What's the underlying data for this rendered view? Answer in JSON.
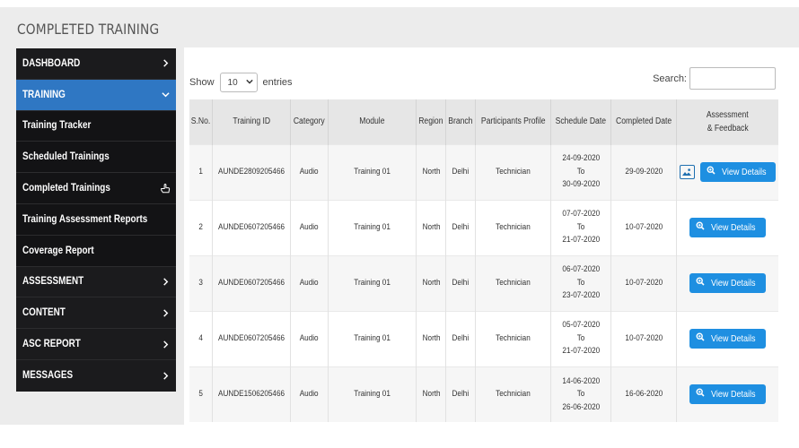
{
  "page": {
    "title": "COMPLETED TRAINING"
  },
  "sidebar": {
    "items": [
      {
        "label": "DASHBOARD"
      },
      {
        "label": "TRAINING"
      },
      {
        "label": "Training Tracker"
      },
      {
        "label": "Scheduled Trainings"
      },
      {
        "label": "Completed Trainings"
      },
      {
        "label": "Training Assessment Reports"
      },
      {
        "label": "Coverage Report"
      },
      {
        "label": "ASSESSMENT"
      },
      {
        "label": "CONTENT"
      },
      {
        "label": "ASC REPORT"
      },
      {
        "label": "MESSAGES"
      }
    ]
  },
  "controls": {
    "show_label": "Show",
    "entries_value": "10",
    "entries_label": "entries",
    "search_label": "Search:"
  },
  "table": {
    "headers": [
      "S.No.",
      "Training ID",
      "Category",
      "Module",
      "Region",
      "Branch",
      "Participants Profile",
      "Schedule Date",
      "Completed Date",
      "Assessment",
      "& Feedback"
    ],
    "date_sep": "To",
    "view_label": "View Details",
    "rows": [
      {
        "sno": "1",
        "id": "AUNDE2809205466",
        "category": "Audio",
        "module": "Training 01",
        "region": "North",
        "branch": "Delhi",
        "profile": "Technician",
        "from": "24-09-2020",
        "to": "30-09-2020",
        "completed": "29-09-2020"
      },
      {
        "sno": "2",
        "id": "AUNDE0607205466",
        "category": "Audio",
        "module": "Training 01",
        "region": "North",
        "branch": "Delhi",
        "profile": "Technician",
        "from": "07-07-2020",
        "to": "21-07-2020",
        "completed": "10-07-2020"
      },
      {
        "sno": "3",
        "id": "AUNDE0607205466",
        "category": "Audio",
        "module": "Training 01",
        "region": "North",
        "branch": "Delhi",
        "profile": "Technician",
        "from": "06-07-2020",
        "to": "23-07-2020",
        "completed": "10-07-2020"
      },
      {
        "sno": "4",
        "id": "AUNDE0607205466",
        "category": "Audio",
        "module": "Training 01",
        "region": "North",
        "branch": "Delhi",
        "profile": "Technician",
        "from": "05-07-2020",
        "to": "21-07-2020",
        "completed": "10-07-2020"
      },
      {
        "sno": "5",
        "id": "AUNDE1506205466",
        "category": "Audio",
        "module": "Training 01",
        "region": "North",
        "branch": "Delhi",
        "profile": "Technician",
        "from": "14-06-2020",
        "to": "26-06-2020",
        "completed": "16-06-2020"
      }
    ]
  },
  "colors": {
    "accent": "#2f77c3",
    "button": "#1e8fe1",
    "sidebar": "#1b1b1d"
  },
  "icons": {
    "chevron": "chevron-right-icon",
    "expanded": "chevron-down-icon",
    "pointer": "hand-pointer-icon",
    "search": "search-plus-icon",
    "image": "image-icon"
  }
}
